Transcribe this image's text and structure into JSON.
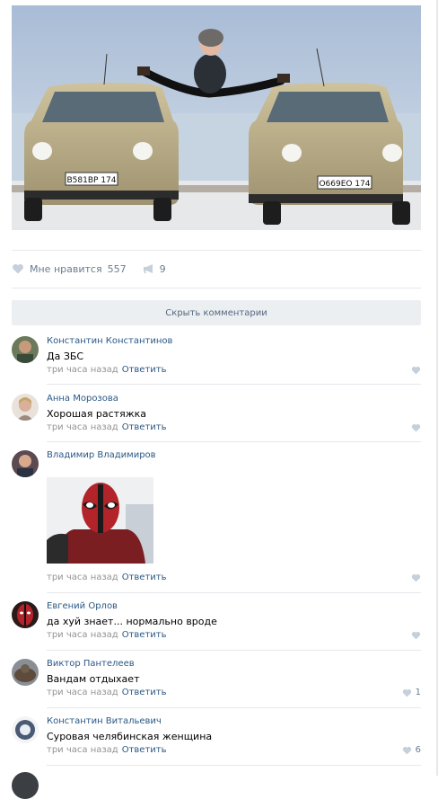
{
  "post": {
    "likes_label": "Мне нравится",
    "likes_count": "557",
    "reposts_count": "9"
  },
  "hide_comments_label": "Скрыть комментарии",
  "comments": [
    {
      "author": "Константин Константинов",
      "text": "Да ЗБС",
      "time": "три часа назад",
      "reply": "Ответить",
      "likes": ""
    },
    {
      "author": "Анна Морозова",
      "text": "Хорошая растяжка",
      "time": "три часа назад",
      "reply": "Ответить",
      "likes": ""
    },
    {
      "author": "Владимир Владимиров",
      "text": "",
      "time": "три часа назад",
      "reply": "Ответить",
      "likes": ""
    },
    {
      "author": "Евгений Орлов",
      "text": "да хуй знает... нормально вроде",
      "time": "три часа назад",
      "reply": "Ответить",
      "likes": ""
    },
    {
      "author": "Виктор Пантелеев",
      "text": "Вандам отдыхает",
      "time": "три часа назад",
      "reply": "Ответить",
      "likes": "1"
    },
    {
      "author": "Константин Витальевич",
      "text": "Суровая челябинская женщина",
      "time": "три часа назад",
      "reply": "Ответить",
      "likes": "6"
    }
  ],
  "photo": {
    "plate_left": "В581ВР 174",
    "plate_right": "О669ЕО 174"
  },
  "colors": {
    "link": "#2a5885",
    "meta": "#939393",
    "icon": "#c5d0db",
    "button_bg": "#eceff2"
  }
}
